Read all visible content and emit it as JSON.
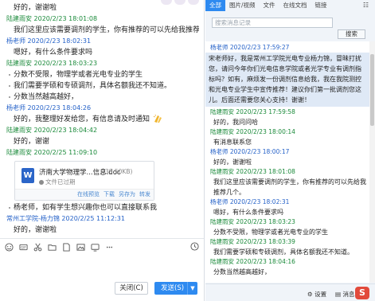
{
  "chat": {
    "lines": [
      {
        "type": "msg",
        "text": "好的，谢谢啦"
      },
      {
        "type": "sender",
        "who": "other",
        "text": "陆建雨安 2020/2/23 18:01:08"
      },
      {
        "type": "msg",
        "text": "我们这里应该需要调剂的学生，你有推荐的可以先给我推荐几个。"
      },
      {
        "type": "sender",
        "who": "me",
        "text": "杨老师 2020/2/23 18:02:31"
      },
      {
        "type": "msg",
        "text": "嗯好，有什么条件要求吗"
      },
      {
        "type": "sender",
        "who": "other",
        "text": "陆建雨安 2020/2/23 18:03:23"
      },
      {
        "type": "bullet",
        "text": "分数不受限，物理学或者光电专业的学生"
      },
      {
        "type": "bullet",
        "text": "我们需要学硕和专硕调剂，具体名额我还不知道。"
      },
      {
        "type": "bullet",
        "text": "分数当然越高越好，"
      },
      {
        "type": "sender",
        "who": "me",
        "text": "杨老师 2020/2/23 18:04:26"
      },
      {
        "type": "msg-emoji",
        "text": "好的，我整理好发给您，有信息请及时通知"
      },
      {
        "type": "sender",
        "who": "other",
        "text": "陆建雨安 2020/2/23 18:04:42"
      },
      {
        "type": "msg",
        "text": "好的，谢谢"
      },
      {
        "type": "sender",
        "who": "other",
        "text": "陆建雨安 2020/2/25 11:09:10"
      }
    ],
    "file": {
      "icon_letter": "W",
      "name": "济南大学物理学...信息.doc",
      "size": "(38.50KB)",
      "status": "文件已过期",
      "actions": [
        "在线预览",
        "下载",
        "另存为",
        "转发"
      ]
    },
    "after": [
      {
        "type": "bullet",
        "text": "杨老师，如有学生想兴趣你也可以直接联系我"
      },
      {
        "type": "sender",
        "who": "me",
        "text": "常州工学院-杨力锦 2020/2/25 11:12:31"
      },
      {
        "type": "msg",
        "text": "好的，谢谢啦"
      }
    ]
  },
  "footer": {
    "close_label": "关闭(C)",
    "send_label": "发送(S)"
  },
  "history": {
    "tabs": [
      "全部",
      "图片/视频",
      "文件",
      "在线文档",
      "链接"
    ],
    "search_placeholder": "搜索消息记录",
    "search_button": "搜索",
    "entries": [
      {
        "who": "me",
        "sender": "杨老师 2020/2/23 17:59:27",
        "text": "宋老师好，我是常州工学院光电专业杨力锦，冒昧打扰您，请问今年你们光电信息学院或者光学专业有调剂指标吗？如有，麻烦发一份调剂信息给我，我在我院测控和光电专业学生中宣传推荐！建议你们第一批调剂您这儿。后面还需要您关心支持！谢谢！",
        "highlight": true
      },
      {
        "who": "other",
        "sender": "陆建雨安 2020/2/23 17:59:58",
        "text": "好的，我问问哈"
      },
      {
        "who": "other",
        "sender": "陆建雨安 2020/2/23 18:00:14",
        "text": "有消息联系您"
      },
      {
        "who": "me",
        "sender": "杨老师 2020/2/23 18:00:17",
        "text": "好的，谢谢啦"
      },
      {
        "who": "other",
        "sender": "陆建雨安 2020/2/23 18:01:08",
        "text": "我们这里应该需要调剂的学生，你有推荐的可以先给我推荐几个。"
      },
      {
        "who": "me",
        "sender": "杨老师 2020/2/23 18:02:31",
        "text": "嗯好，有什么条件要求吗"
      },
      {
        "who": "other",
        "sender": "陆建雨安 2020/2/23 18:03:23",
        "text": "分数不受限，物理学或者光电专业的学生"
      },
      {
        "who": "other",
        "sender": "陆建雨安 2020/2/23 18:03:39",
        "text": "我们需要学硕和专硕调剂，具体名额我还不知道。"
      },
      {
        "who": "other",
        "sender": "陆建雨安 2020/2/23 18:04:16",
        "text": "分数当然越高越好，"
      }
    ],
    "settings_label": "设置",
    "manager_label": "消息管",
    "logo_letter": "S"
  }
}
